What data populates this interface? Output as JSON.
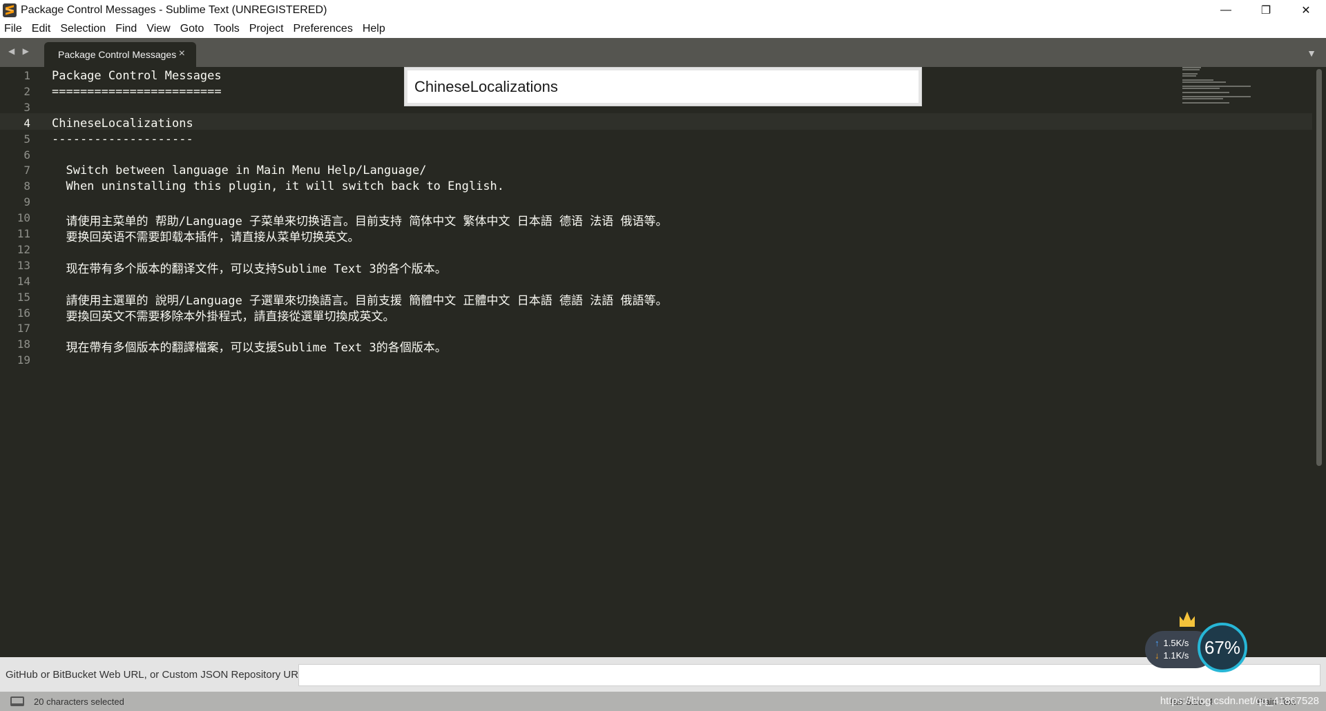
{
  "window": {
    "title": "Package Control Messages - Sublime Text (UNREGISTERED)",
    "minimize": "—",
    "restore": "❐",
    "close": "✕"
  },
  "menu": [
    "File",
    "Edit",
    "Selection",
    "Find",
    "View",
    "Goto",
    "Tools",
    "Project",
    "Preferences",
    "Help"
  ],
  "tab": {
    "label": "Package Control Messages",
    "close": "×",
    "nav": "◀ ▶",
    "dropdown": "▼"
  },
  "editor": {
    "active_line": 4,
    "lines": [
      "Package Control Messages",
      "========================",
      "",
      "ChineseLocalizations",
      "--------------------",
      "",
      "  Switch between language in Main Menu Help/Language/",
      "  When uninstalling this plugin, it will switch back to English.",
      "",
      "  请使用主菜单的 帮助/Language 子菜单来切换语言。目前支持 简体中文 繁体中文 日本語 德语 法语 俄语等。",
      "  要换回英语不需要卸载本插件，请直接从菜单切换英文。",
      "",
      "  现在带有多个版本的翻译文件，可以支持Sublime Text 3的各个版本。",
      "",
      "  請使用主選單的 說明/Language 子選單來切換語言。目前支援 簡體中文 正體中文 日本語 德語 法語 俄語等。",
      "  要換回英文不需要移除本外掛程式，請直接從選單切換成英文。",
      "",
      "  現在帶有多個版本的翻譯檔案，可以支援Sublime Text 3的各個版本。",
      ""
    ]
  },
  "popup": {
    "text": "ChineseLocalizations"
  },
  "input_panel": {
    "label": "GitHub or BitBucket Web URL, or Custom JSON Repository URL",
    "value": ""
  },
  "status": {
    "selection": "20 characters selected",
    "tab_size": "Tab Size: 4",
    "syntax": "Plain Text",
    "watermark": "https://blog.csdn.net/qq_41867528"
  },
  "network_widget": {
    "upload": "1.5K/s",
    "download": "1.1K/s",
    "percent": "67%"
  }
}
